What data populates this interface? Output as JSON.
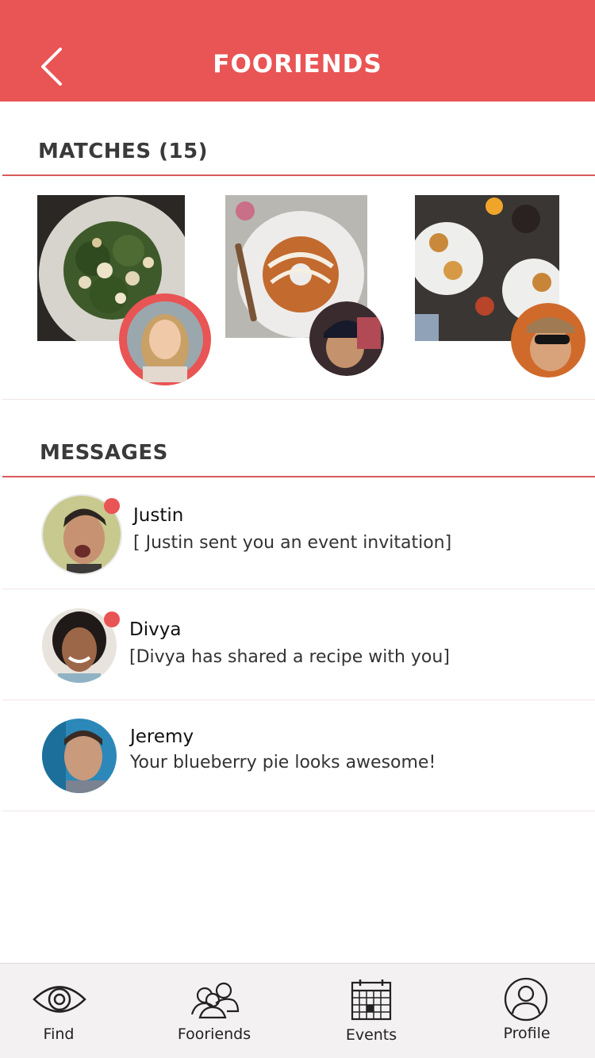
{
  "header": {
    "title": "FOORIENDS",
    "back_icon": "chevron-left-icon"
  },
  "matches": {
    "title": "MATCHES (15)",
    "items": [
      {
        "food": "greens-grain-dish",
        "person": "blonde-woman",
        "highlighted": true
      },
      {
        "food": "bundt-cake",
        "person": "man-in-beanie",
        "highlighted": false
      },
      {
        "food": "plated-appetizers",
        "person": "man-in-sunglasses",
        "highlighted": false
      }
    ]
  },
  "messages": {
    "title": "MESSAGES",
    "items": [
      {
        "name": "Justin",
        "text": "[ Justin sent you an event invitation]",
        "unread": true
      },
      {
        "name": "Divya",
        "text": "[Divya has shared a recipe with you]",
        "unread": true
      },
      {
        "name": "Jeremy",
        "text": "Your blueberry pie looks awesome!",
        "unread": false
      }
    ]
  },
  "tabs": [
    {
      "label": "Find",
      "icon": "eye-icon"
    },
    {
      "label": "Fooriends",
      "icon": "people-icon"
    },
    {
      "label": "Events",
      "icon": "calendar-icon"
    },
    {
      "label": "Profile",
      "icon": "user-circle-icon"
    }
  ],
  "colors": {
    "accent": "#e95454",
    "unread_dot": "#e95454",
    "tabbar_bg": "#f3f1f1"
  }
}
